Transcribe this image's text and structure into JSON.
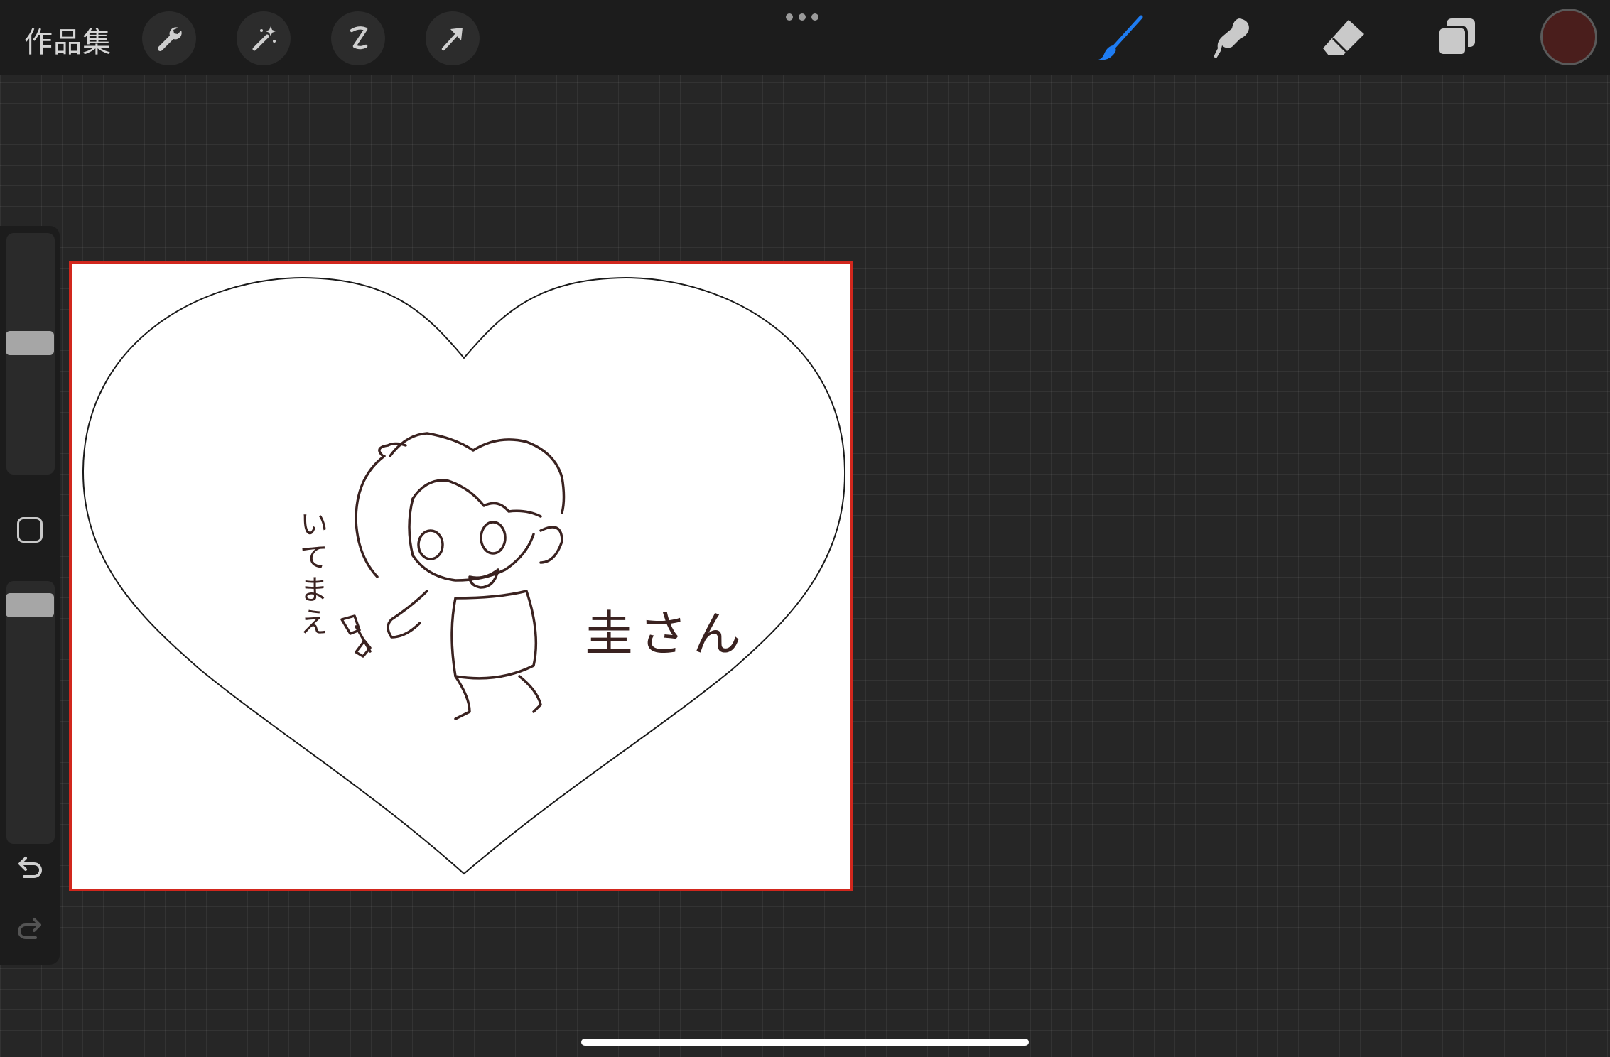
{
  "topbar": {
    "gallery_label": "作品集",
    "left_tools": [
      "wrench-icon",
      "magic-wand-icon",
      "selection-icon",
      "transform-arrow-icon"
    ],
    "right_tools": [
      "brush-icon",
      "smudge-icon",
      "eraser-icon",
      "layers-icon"
    ],
    "active_tool": "brush",
    "accent_color": "#1e7cf2",
    "current_color": "#4a1e1c"
  },
  "sidebar": {
    "brush_size_level": 0.55,
    "opacity_level": 0.95,
    "icons": [
      "modify-square-icon",
      "undo-icon",
      "redo-icon"
    ]
  },
  "canvas": {
    "vertical_text": "いてまえ",
    "name_text": "圭さん",
    "border_color": "#d1271d",
    "line_color": "#3a2220"
  }
}
